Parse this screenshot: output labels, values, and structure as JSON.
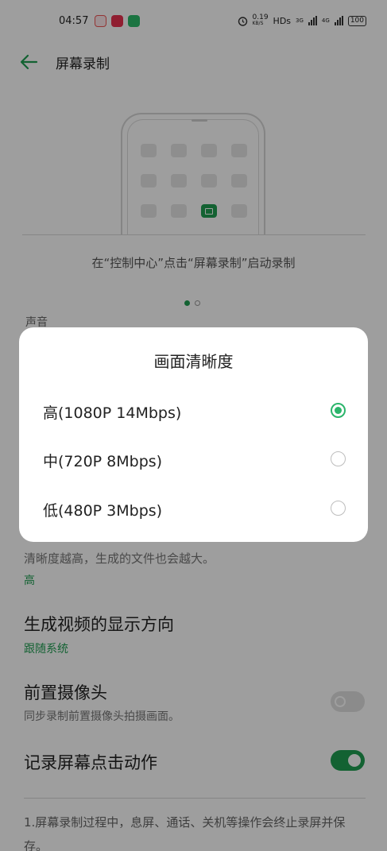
{
  "status_bar": {
    "time": "04:57",
    "net_speed": "0.19",
    "net_unit": "KB/S",
    "hd_label": "HDs",
    "sim1_label": "3G",
    "sim2_label": "4G",
    "battery": "100"
  },
  "header": {
    "title": "屏幕录制"
  },
  "illustration": {
    "caption": "在“控制中心”点击“屏幕录制”启动录制"
  },
  "section": {
    "sound_label": "声音"
  },
  "clarity": {
    "description": "清晰度越高，生成的文件也会越大。",
    "value": "高"
  },
  "orientation": {
    "title": "生成视频的显示方向",
    "value": "跟随系统"
  },
  "front_camera": {
    "title": "前置摄像头",
    "subtitle": "同步录制前置摄像头拍摄画面。",
    "enabled": false
  },
  "record_taps": {
    "title": "记录屏幕点击动作",
    "enabled": true
  },
  "notes": {
    "line1": "1.屏幕录制过程中，息屏、通话、关机等操作会终止录屏并保存。"
  },
  "dialog": {
    "title": "画面清晰度",
    "options": [
      {
        "label": "高(1080P 14Mbps)",
        "selected": true
      },
      {
        "label": "中(720P 8Mbps)",
        "selected": false
      },
      {
        "label": "低(480P 3Mbps)",
        "selected": false
      }
    ]
  },
  "colors": {
    "accent": "#1f9e52",
    "radio": "#2bb56b"
  }
}
